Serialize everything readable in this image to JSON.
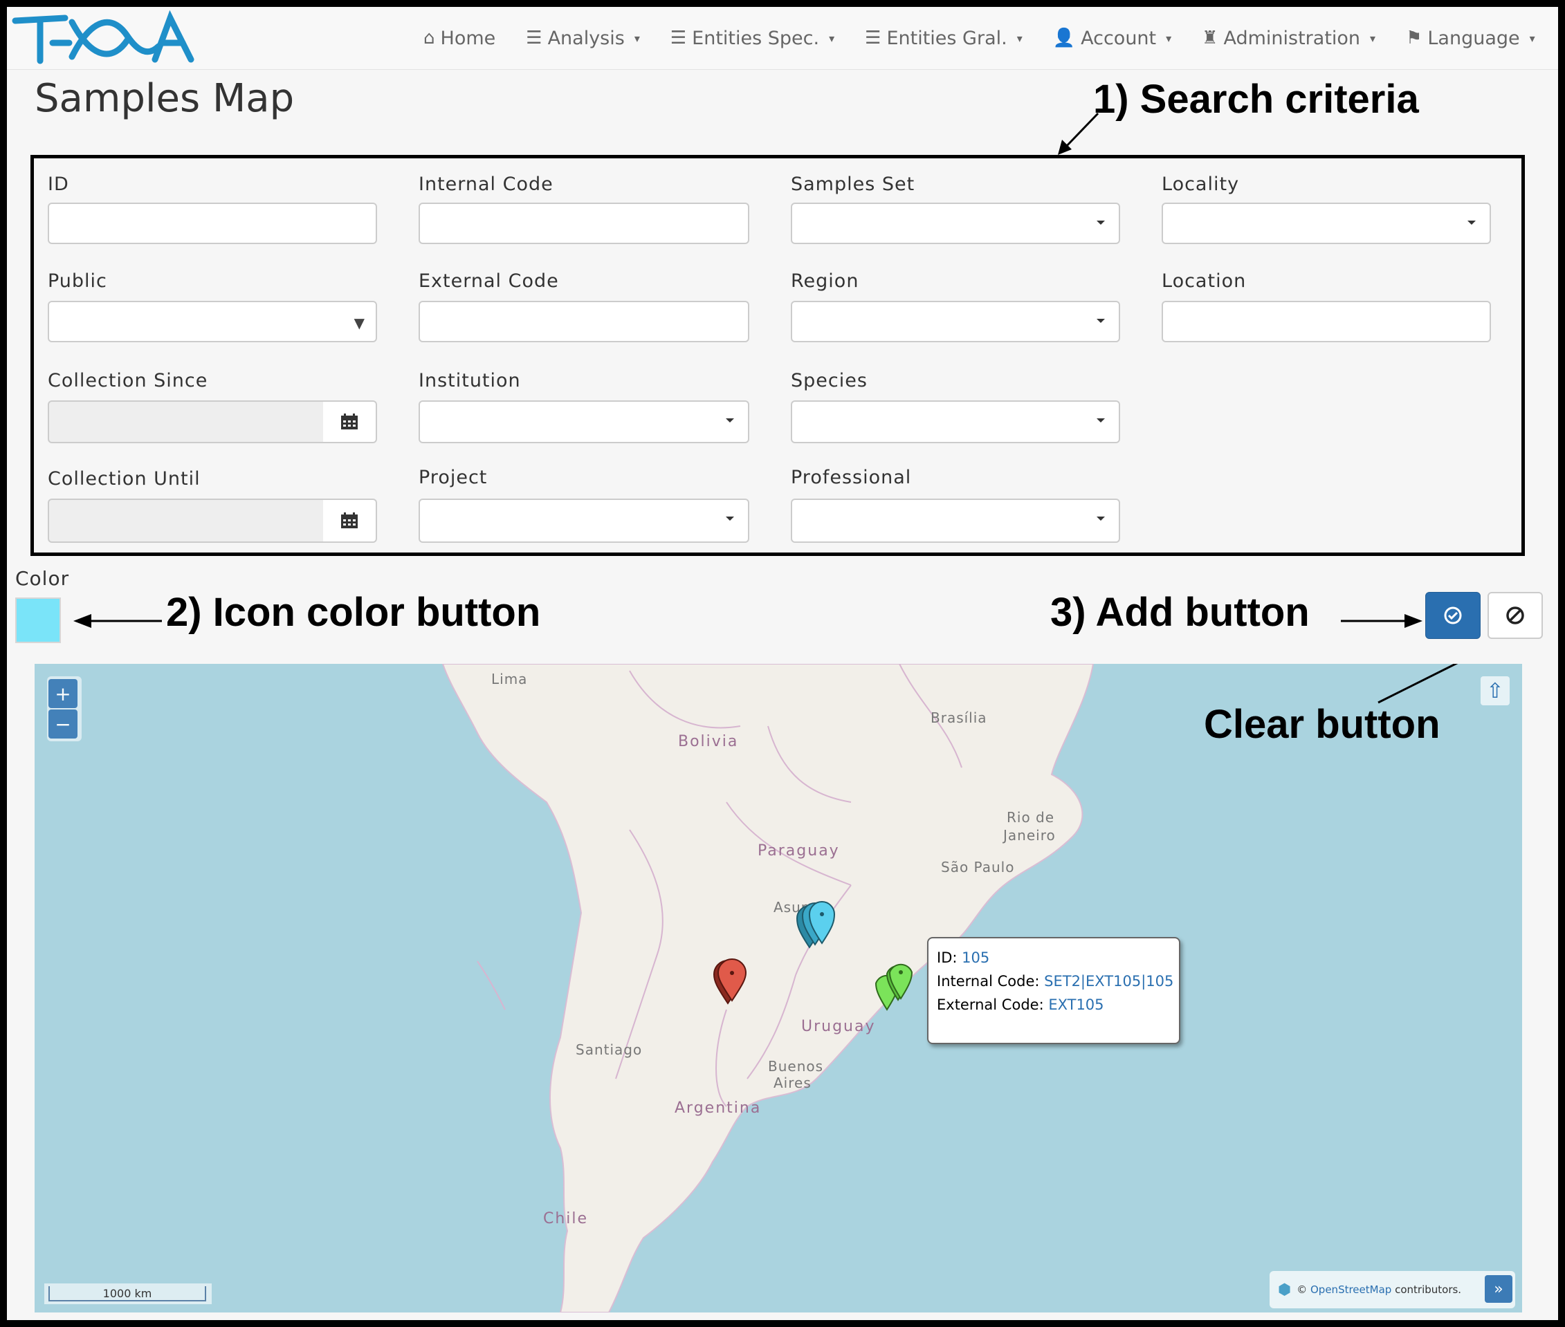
{
  "nav": {
    "home": "Home",
    "analysis": "Analysis",
    "entities_spec": "Entities Spec.",
    "entities_gral": "Entities Gral.",
    "account": "Account",
    "administration": "Administration",
    "language": "Language"
  },
  "page": {
    "title": "Samples Map"
  },
  "annotations": {
    "search_criteria": "1) Search criteria",
    "icon_color": "2) Icon color button",
    "add": "3) Add button",
    "clear": "Clear button"
  },
  "form": {
    "id": "ID",
    "internal_code": "Internal Code",
    "samples_set": "Samples Set",
    "locality": "Locality",
    "public": "Public",
    "external_code": "External Code",
    "region": "Region",
    "location": "Location",
    "collection_since": "Collection Since",
    "institution": "Institution",
    "species": "Species",
    "collection_until": "Collection Until",
    "project": "Project",
    "professional": "Professional"
  },
  "color": {
    "label": "Color",
    "value": "#7ae4f9"
  },
  "map": {
    "zoom_in": "+",
    "zoom_out": "−",
    "scale": "1000 km",
    "attribution_prefix": "©",
    "attribution_link": "OpenStreetMap",
    "attribution_suffix": "contributors.",
    "labels": {
      "lima": "Lima",
      "bolivia": "Bolivia",
      "brasilia": "Brasília",
      "rio": "Rio de",
      "janeiro": "Janeiro",
      "paraguay": "Paraguay",
      "sao_paulo": "São Paulo",
      "asuncion": "Asun",
      "santiago": "Santiago",
      "uruguay": "Uruguay",
      "buenos": "Buenos",
      "aires": "Aires",
      "argentina": "Argentina",
      "chile": "Chile"
    },
    "popup": {
      "id_label": "ID:",
      "id_value": "105",
      "internal_label": "Internal Code:",
      "internal_value": "SET2|EXT105|105",
      "external_label": "External Code:",
      "external_value": "EXT105"
    },
    "marker_colors": {
      "blue": "#5bd0ee",
      "blue_dark": "#2c8aa5",
      "green": "#7be35a",
      "red": "#e05a4a"
    }
  }
}
